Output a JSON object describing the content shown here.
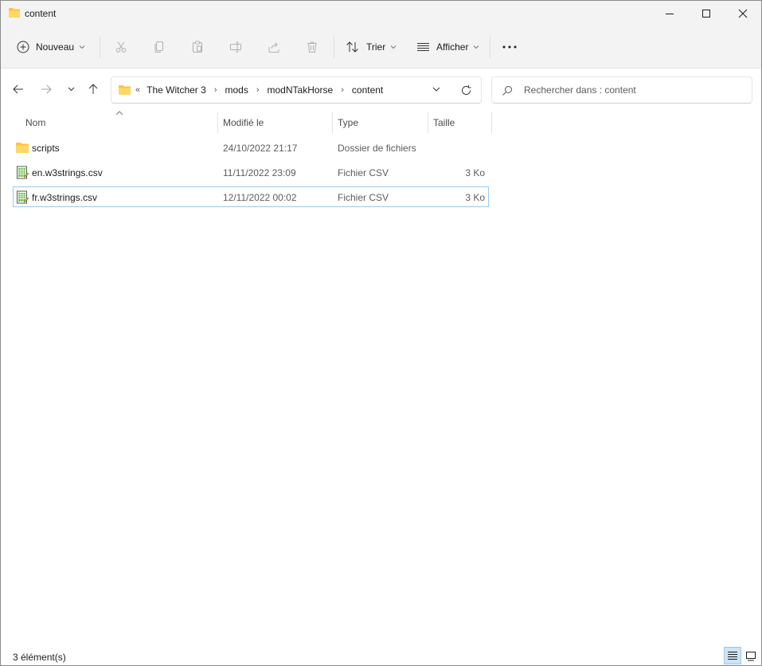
{
  "window": {
    "title": "content"
  },
  "toolbar": {
    "new_label": "Nouveau",
    "sort_label": "Trier",
    "view_label": "Afficher"
  },
  "address": {
    "overflow": "«",
    "crumbs": [
      "The Witcher 3",
      "mods",
      "modNTakHorse",
      "content"
    ],
    "separator": "›"
  },
  "search": {
    "placeholder": "Rechercher dans : content"
  },
  "columns": {
    "name": "Nom",
    "modified": "Modifié le",
    "type": "Type",
    "size": "Taille"
  },
  "files": [
    {
      "name": "scripts",
      "modified": "24/10/2022 21:17",
      "type": "Dossier de fichiers",
      "size": "",
      "icon": "folder-icon"
    },
    {
      "name": "en.w3strings.csv",
      "modified": "11/11/2022 23:09",
      "type": "Fichier CSV",
      "size": "3 Ko",
      "icon": "csv-file-icon"
    },
    {
      "name": "fr.w3strings.csv",
      "modified": "12/11/2022 00:02",
      "type": "Fichier CSV",
      "size": "3 Ko",
      "icon": "csv-file-icon",
      "selected": true
    }
  ],
  "status": {
    "count": "3 élément(s)"
  },
  "colors": {
    "folder": "#f8c443",
    "selection_border": "#99c9ef",
    "chrome": "#f3f3f3"
  }
}
